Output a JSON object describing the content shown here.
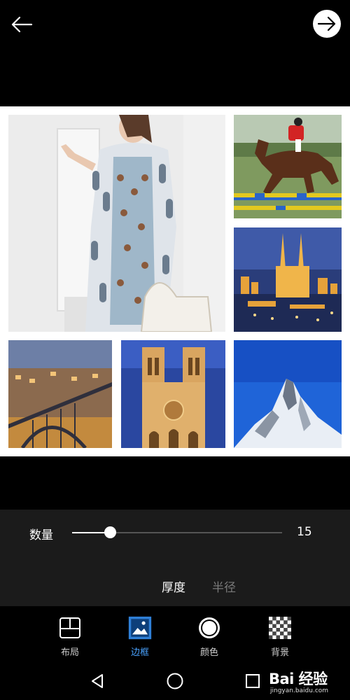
{
  "header": {
    "back_icon": "arrow-left-icon",
    "next_icon": "arrow-right-circle-icon"
  },
  "collage": {
    "photos": [
      {
        "subject": "woman-in-patterned-coat"
      },
      {
        "subject": "show-jumping-horse"
      },
      {
        "subject": "cathedral-night-city"
      },
      {
        "subject": "bridge-city-dusk"
      },
      {
        "subject": "notre-dame-facade"
      },
      {
        "subject": "matterhorn-mountain"
      }
    ]
  },
  "controls": {
    "slider": {
      "label": "数量",
      "value": "15",
      "fraction": 0.18
    },
    "subtabs": [
      {
        "label": "厚度",
        "active": true
      },
      {
        "label": "半径",
        "active": false
      }
    ]
  },
  "toolbar": {
    "items": [
      {
        "label": "布局",
        "icon": "layout-grid-icon",
        "active": false
      },
      {
        "label": "边框",
        "icon": "frame-image-icon",
        "active": true
      },
      {
        "label": "颜色",
        "icon": "color-circle-icon",
        "active": false
      },
      {
        "label": "背景",
        "icon": "checkerboard-icon",
        "active": false
      }
    ]
  },
  "system_nav": {
    "back_icon": "triangle-back-icon",
    "home_icon": "circle-home-icon",
    "recents_icon": "square-recents-icon"
  },
  "watermark": {
    "brand": "Bai 经验",
    "url": "jingyan.baidu.com"
  },
  "colors": {
    "accent": "#4aa3ff",
    "panel": "#1b1b1b",
    "background": "#000000"
  }
}
